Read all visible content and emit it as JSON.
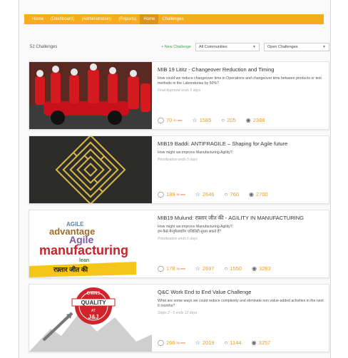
{
  "nav": {
    "items": [
      {
        "label": "Home",
        "active": false
      },
      {
        "label": "(Dashboard)",
        "active": false
      },
      {
        "label": "(Administration)",
        "active": false
      },
      {
        "label": "(Reports)",
        "active": false
      },
      {
        "label": "Home",
        "active": true
      },
      {
        "label": "Challenges",
        "active": false
      }
    ]
  },
  "toolbar": {
    "count": "52 Challenges",
    "new_challenge": "+ New Challenge",
    "community_filter": "All Communities",
    "status_filter": "Open Challenges"
  },
  "challenges": [
    {
      "title": "MIB 19 Lititz - Changeover Reduction and Timing",
      "description": "How could we reduce changeover time in Operations and changeover time between products or test methods in the Laboratories by 50%?",
      "phase": "Final Approval ends 5 days",
      "ideas": "70",
      "ideas_new": "10 new",
      "votes": "1585",
      "comments": "205",
      "views": "2388",
      "image": "pit-crew-photo"
    },
    {
      "title": "MIB19 Baddi: ANTIFRAGILE – Shaping for Agile future",
      "description": "How might we improve Manufacturing Agility?",
      "phase": "Prioritization ends 5 days",
      "ideas": "189",
      "ideas_new": "55 new",
      "votes": "2646",
      "comments": "760",
      "views": "2700",
      "image": "maze-image"
    },
    {
      "title": "MIB19 Mulund: रफ़्तार जीत की - AGILITY IN MANUFACTURING",
      "description": "How might we improve Manufacturing Agility?\nहम कैसे मैन्युफैक्चरिंग एजिलिटी सुधार सकते हैं?",
      "phase": "Prioritization ends 6 days",
      "ideas": "178",
      "ideas_new": "15 new",
      "votes": "2697",
      "comments": "1550",
      "views": "3283",
      "image": "word-cloud",
      "image_words": [
        "advantage",
        "Agile",
        "manufacturing",
        "lean",
        "AGILE"
      ],
      "image_banner": "रफ़्तार जीत की"
    },
    {
      "title": "Q&C Work End to End Value Challenge",
      "description": "What are some ways we could reduce complexity and eliminate non value-added activities in the next 6 months?",
      "phase": "Steps 2 - 6 ends 12 days",
      "ideas": "266",
      "ideas_new": "15 new",
      "votes": "2019",
      "comments": "1144",
      "views": "3257",
      "image": "quality-logo",
      "image_words": [
        "OWNS",
        "QUALITY",
        "AT",
        "J&J"
      ]
    }
  ],
  "colors": {
    "accent": "#f4ad1d",
    "accent_dark": "#d9951a",
    "new_link": "#3aa856",
    "stat_number": "#e4a21d"
  }
}
